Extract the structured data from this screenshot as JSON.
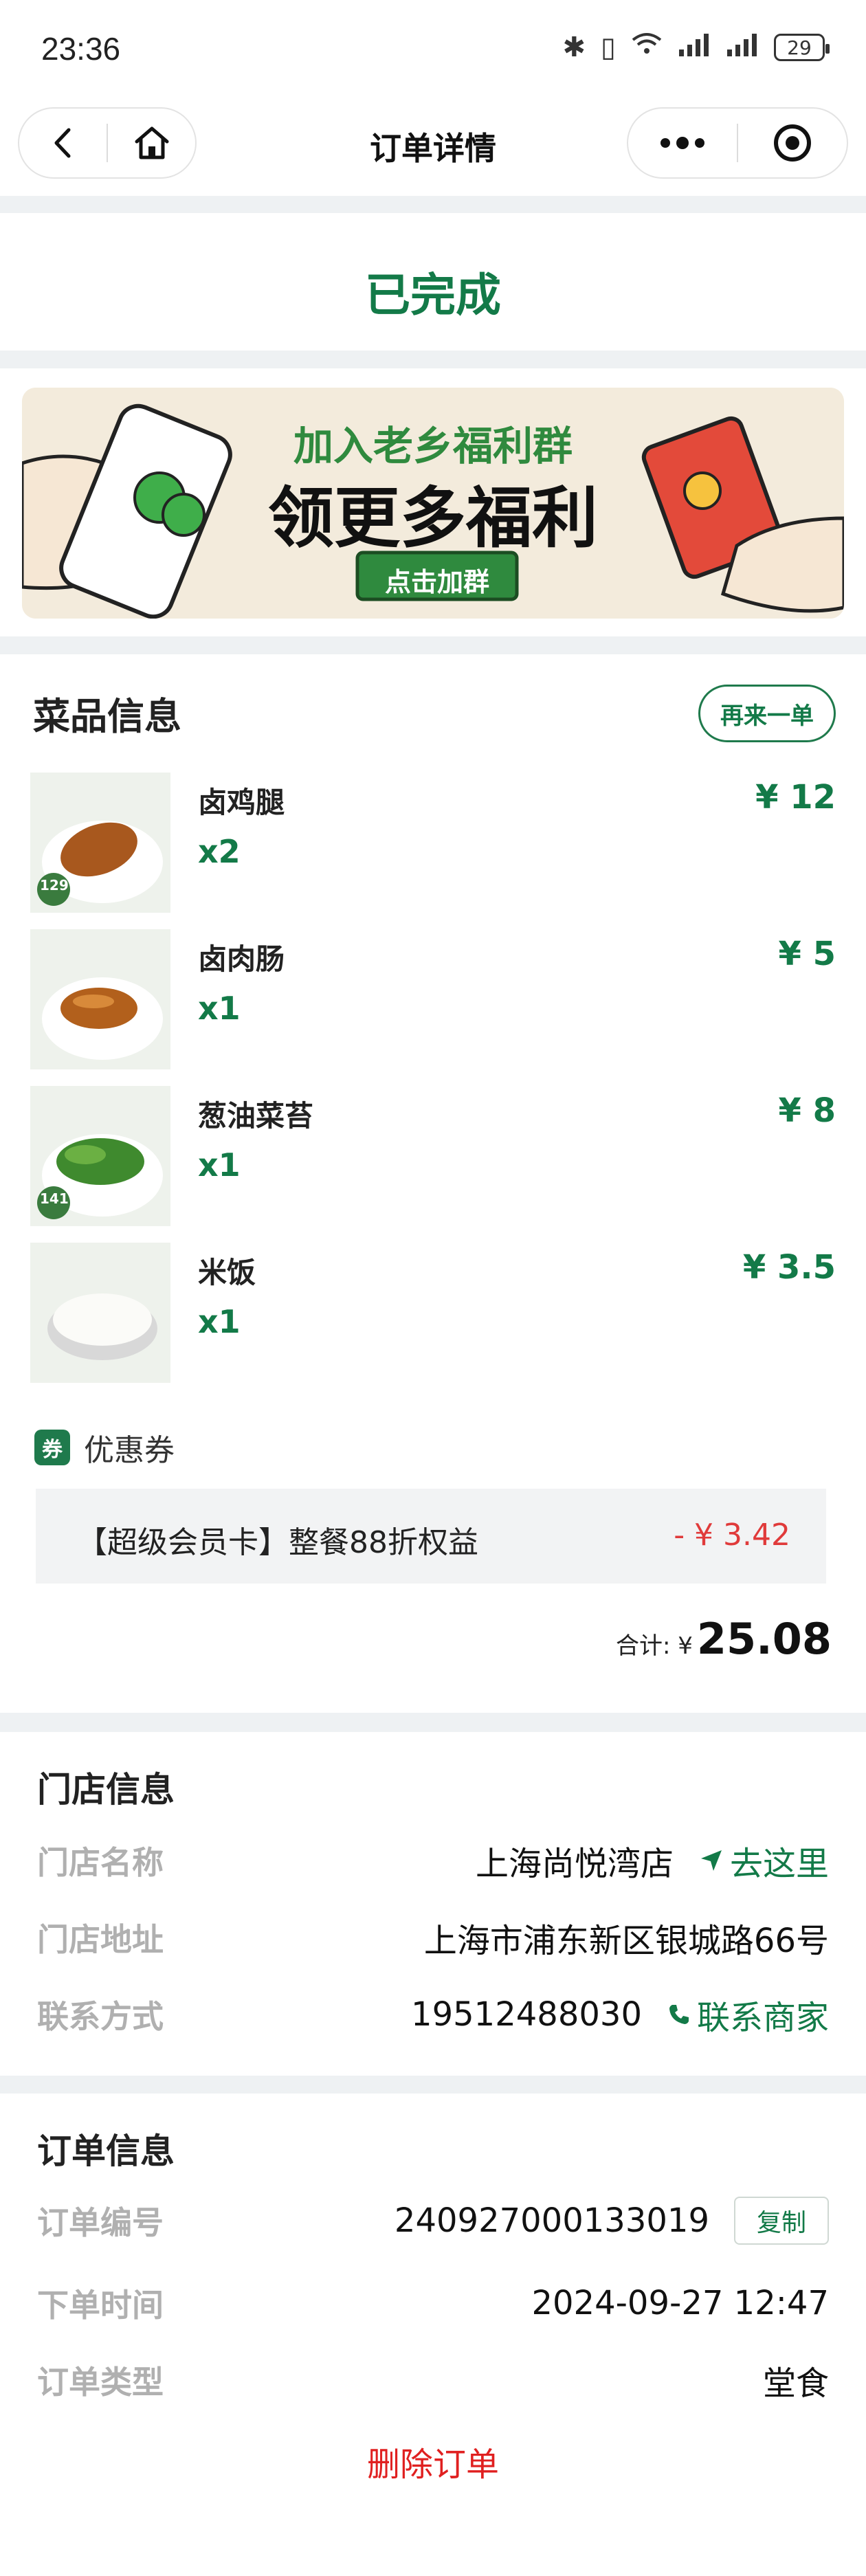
{
  "status_bar": {
    "time": "23:36",
    "battery": "29"
  },
  "nav": {
    "title": "订单详情"
  },
  "order_status": "已完成",
  "banner": {
    "line1": "加入老乡福利群",
    "line2": "领更多福利",
    "button": "点击加群"
  },
  "dishes": {
    "title": "菜品信息",
    "reorder": "再来一单",
    "items": [
      {
        "name": "卤鸡腿",
        "qty": "x2",
        "price": "¥ 12",
        "tag": "129"
      },
      {
        "name": "卤肉肠",
        "qty": "x1",
        "price": "¥ 5",
        "tag": ""
      },
      {
        "name": "葱油菜苔",
        "qty": "x1",
        "price": "¥ 8",
        "tag": "141"
      },
      {
        "name": "米饭",
        "qty": "x1",
        "price": "¥ 3.5",
        "tag": ""
      }
    ],
    "coupon_tag": "券",
    "coupon_label": "优惠券",
    "coupon_name": "【超级会员卡】整餐88折权益",
    "coupon_value": "- ¥ 3.42",
    "total_label": "合计: ¥",
    "total_value": "25.08"
  },
  "store": {
    "title": "门店信息",
    "name_key": "门店名称",
    "name_val": "上海尚悦湾店",
    "goto": "去这里",
    "addr_key": "门店地址",
    "addr_val": "上海市浦东新区银城路66号",
    "contact_key": "联系方式",
    "contact_val": "19512488030",
    "contact_link": "联系商家"
  },
  "order": {
    "title": "订单信息",
    "no_key": "订单编号",
    "no_val": "240927000133019",
    "copy": "复制",
    "time_key": "下单时间",
    "time_val": "2024-09-27 12:47",
    "type_key": "订单类型",
    "type_val": "堂食",
    "delete": "删除订单"
  }
}
